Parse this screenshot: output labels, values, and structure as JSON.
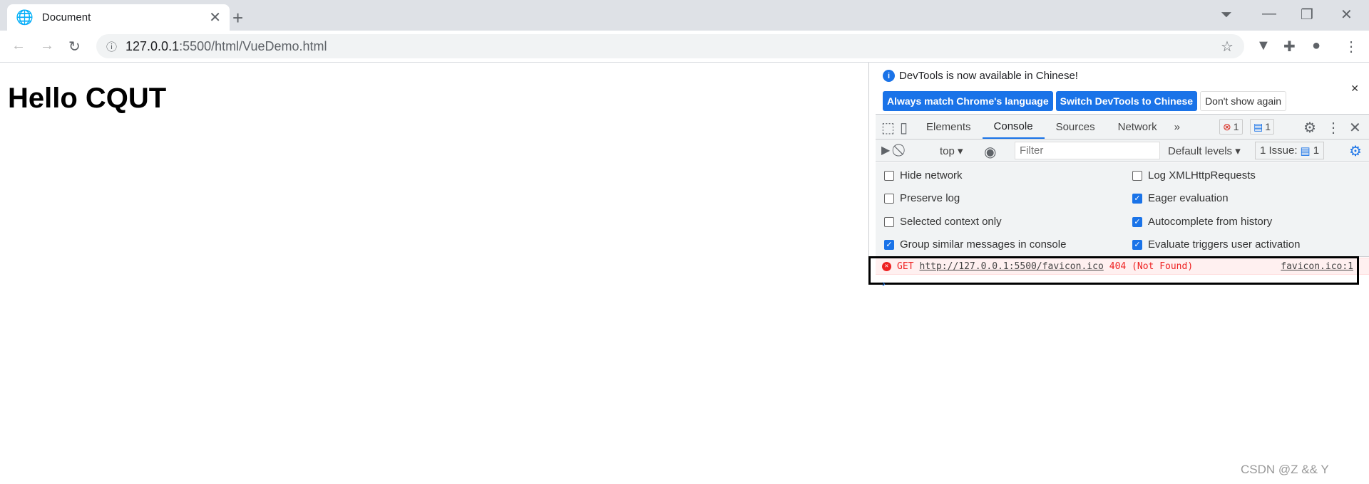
{
  "browser": {
    "tab_title": "Document",
    "url_host": "127.0.0.1",
    "url_rest": ":5500/html/VueDemo.html"
  },
  "page": {
    "heading": "Hello CQUT"
  },
  "devtools": {
    "info": {
      "message": "DevTools is now available in Chinese!",
      "btn_match": "Always match Chrome's language",
      "btn_switch": "Switch DevTools to Chinese",
      "btn_dismiss": "Don't show again"
    },
    "tabs": [
      "Elements",
      "Console",
      "Sources",
      "Network"
    ],
    "active_tab": "Console",
    "error_count": "1",
    "message_count": "1",
    "console_toolbar": {
      "context": "top",
      "filter_placeholder": "Filter",
      "levels": "Default levels",
      "issues": "1 Issue:",
      "issues_count": "1"
    },
    "settings": [
      {
        "label": "Hide network",
        "checked": false
      },
      {
        "label": "Log XMLHttpRequests",
        "checked": false
      },
      {
        "label": "Preserve log",
        "checked": false
      },
      {
        "label": "Eager evaluation",
        "checked": true
      },
      {
        "label": "Selected context only",
        "checked": false
      },
      {
        "label": "Autocomplete from history",
        "checked": true
      },
      {
        "label": "Group similar messages in console",
        "checked": true
      },
      {
        "label": "Evaluate triggers user activation",
        "checked": true
      }
    ],
    "error": {
      "method": "GET",
      "url": "http://127.0.0.1:5500/favicon.ico",
      "status": "404 (Not Found)",
      "source": "favicon.ico:1"
    }
  },
  "watermark": "CSDN @Z && Y"
}
